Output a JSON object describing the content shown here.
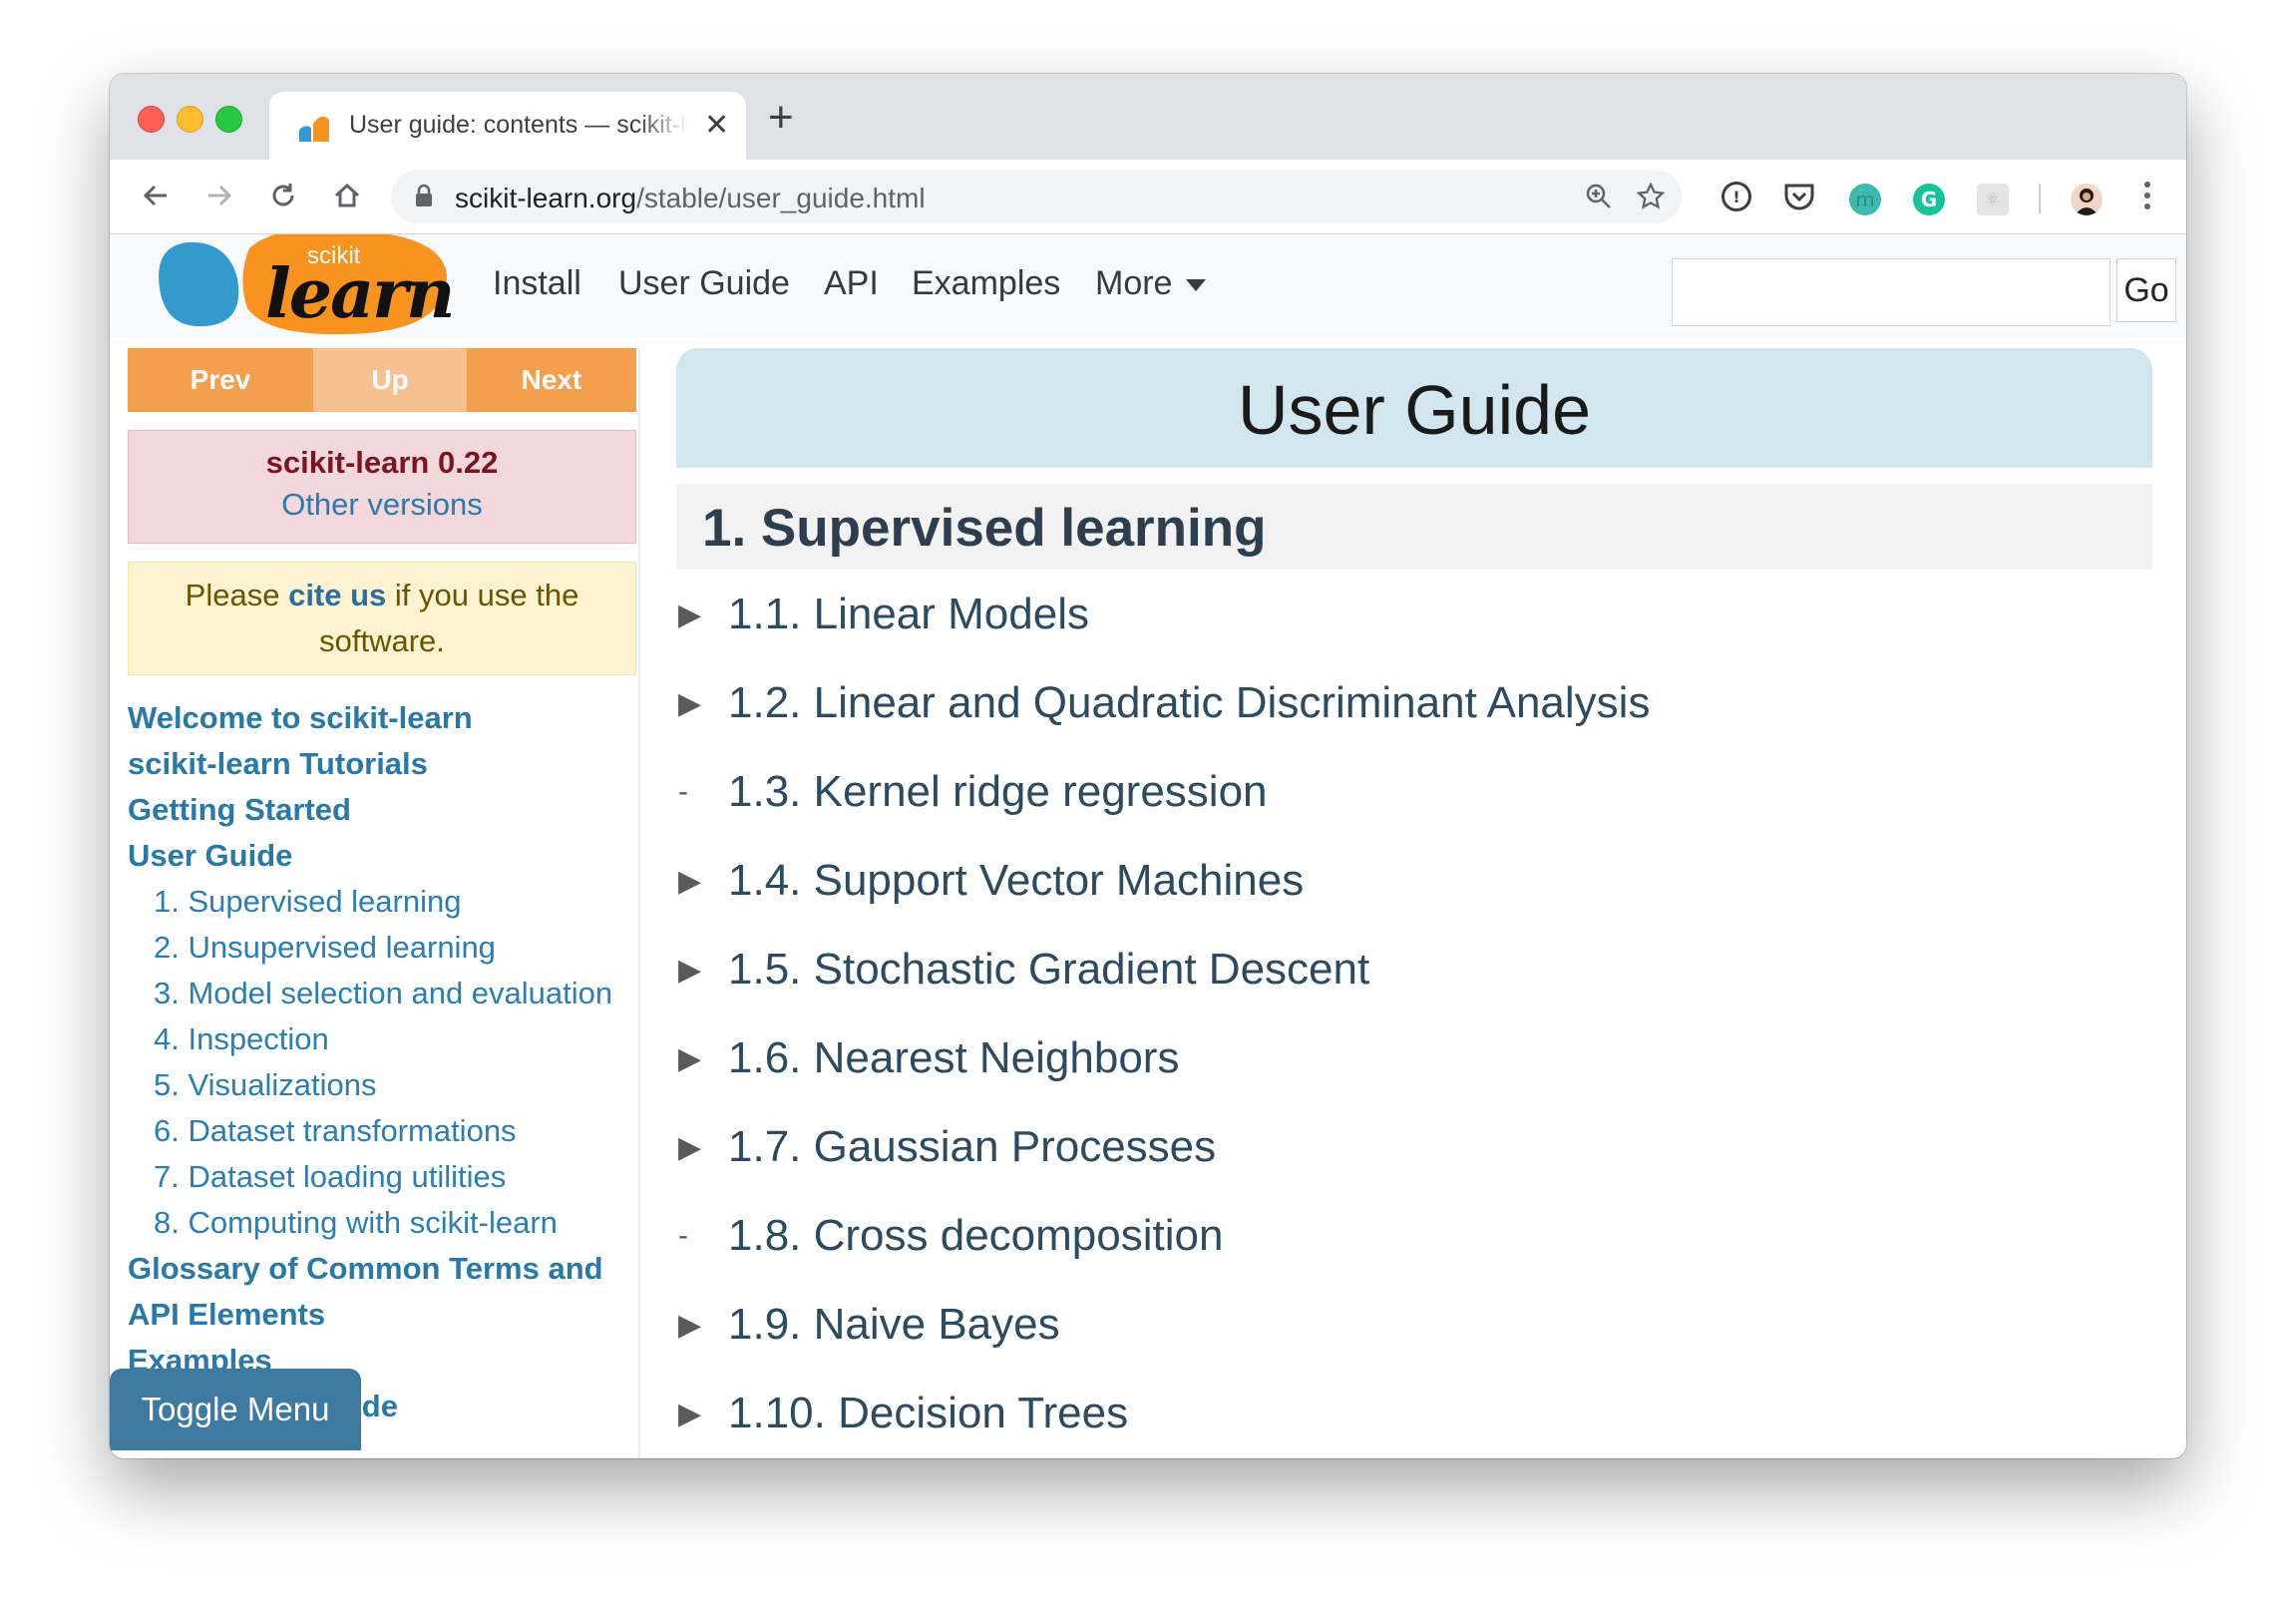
{
  "browser": {
    "tab_title": "User guide: contents — scikit-learn",
    "url_host": "scikit-learn.org",
    "url_path": "/stable/user_guide.html"
  },
  "navbar": {
    "logo_top": "scikit",
    "logo_main": "learn",
    "links": [
      "Install",
      "User Guide",
      "API",
      "Examples",
      "More"
    ],
    "search_placeholder": "",
    "go_label": "Go"
  },
  "sidebar": {
    "prev": "Prev",
    "up": "Up",
    "next": "Next",
    "version": "scikit-learn 0.22",
    "other_versions": "Other versions",
    "cite_pre": "Please ",
    "cite_link": "cite us",
    "cite_post": " if you use the software.",
    "toc": [
      {
        "label": "Welcome to scikit-learn",
        "level": 0
      },
      {
        "label": "scikit-learn Tutorials",
        "level": 0
      },
      {
        "label": "Getting Started",
        "level": 0
      },
      {
        "label": "User Guide",
        "level": 0
      },
      {
        "label": "1. Supervised learning",
        "level": 1
      },
      {
        "label": "2. Unsupervised learning",
        "level": 1
      },
      {
        "label": "3. Model selection and evaluation",
        "level": 1
      },
      {
        "label": "4. Inspection",
        "level": 1
      },
      {
        "label": "5. Visualizations",
        "level": 1
      },
      {
        "label": "6. Dataset transformations",
        "level": 1
      },
      {
        "label": "7. Dataset loading utilities",
        "level": 1
      },
      {
        "label": "8. Computing with scikit-learn",
        "level": 1
      },
      {
        "label": "Glossary of Common Terms and API Elements",
        "level": 0
      },
      {
        "label": "Examples",
        "level": 0
      },
      {
        "label": "Developer's Guide",
        "level": 0
      }
    ],
    "toggle_menu": "Toggle Menu"
  },
  "main": {
    "title": "User Guide",
    "section": "1. Supervised learning",
    "items": [
      {
        "marker": "▶",
        "label": "1.1. Linear Models"
      },
      {
        "marker": "▶",
        "label": "1.2. Linear and Quadratic Discriminant Analysis"
      },
      {
        "marker": "-",
        "label": "1.3. Kernel ridge regression"
      },
      {
        "marker": "▶",
        "label": "1.4. Support Vector Machines"
      },
      {
        "marker": "▶",
        "label": "1.5. Stochastic Gradient Descent"
      },
      {
        "marker": "▶",
        "label": "1.6. Nearest Neighbors"
      },
      {
        "marker": "▶",
        "label": "1.7. Gaussian Processes"
      },
      {
        "marker": "-",
        "label": "1.8. Cross decomposition"
      },
      {
        "marker": "▶",
        "label": "1.9. Naive Bayes"
      },
      {
        "marker": "▶",
        "label": "1.10. Decision Trees"
      }
    ]
  },
  "colors": {
    "accent_orange": "#f29f4e",
    "accent_orange_light": "#f7c18f",
    "link_blue": "#2878a8",
    "toggle_menu_bg": "#3e7aa0"
  }
}
